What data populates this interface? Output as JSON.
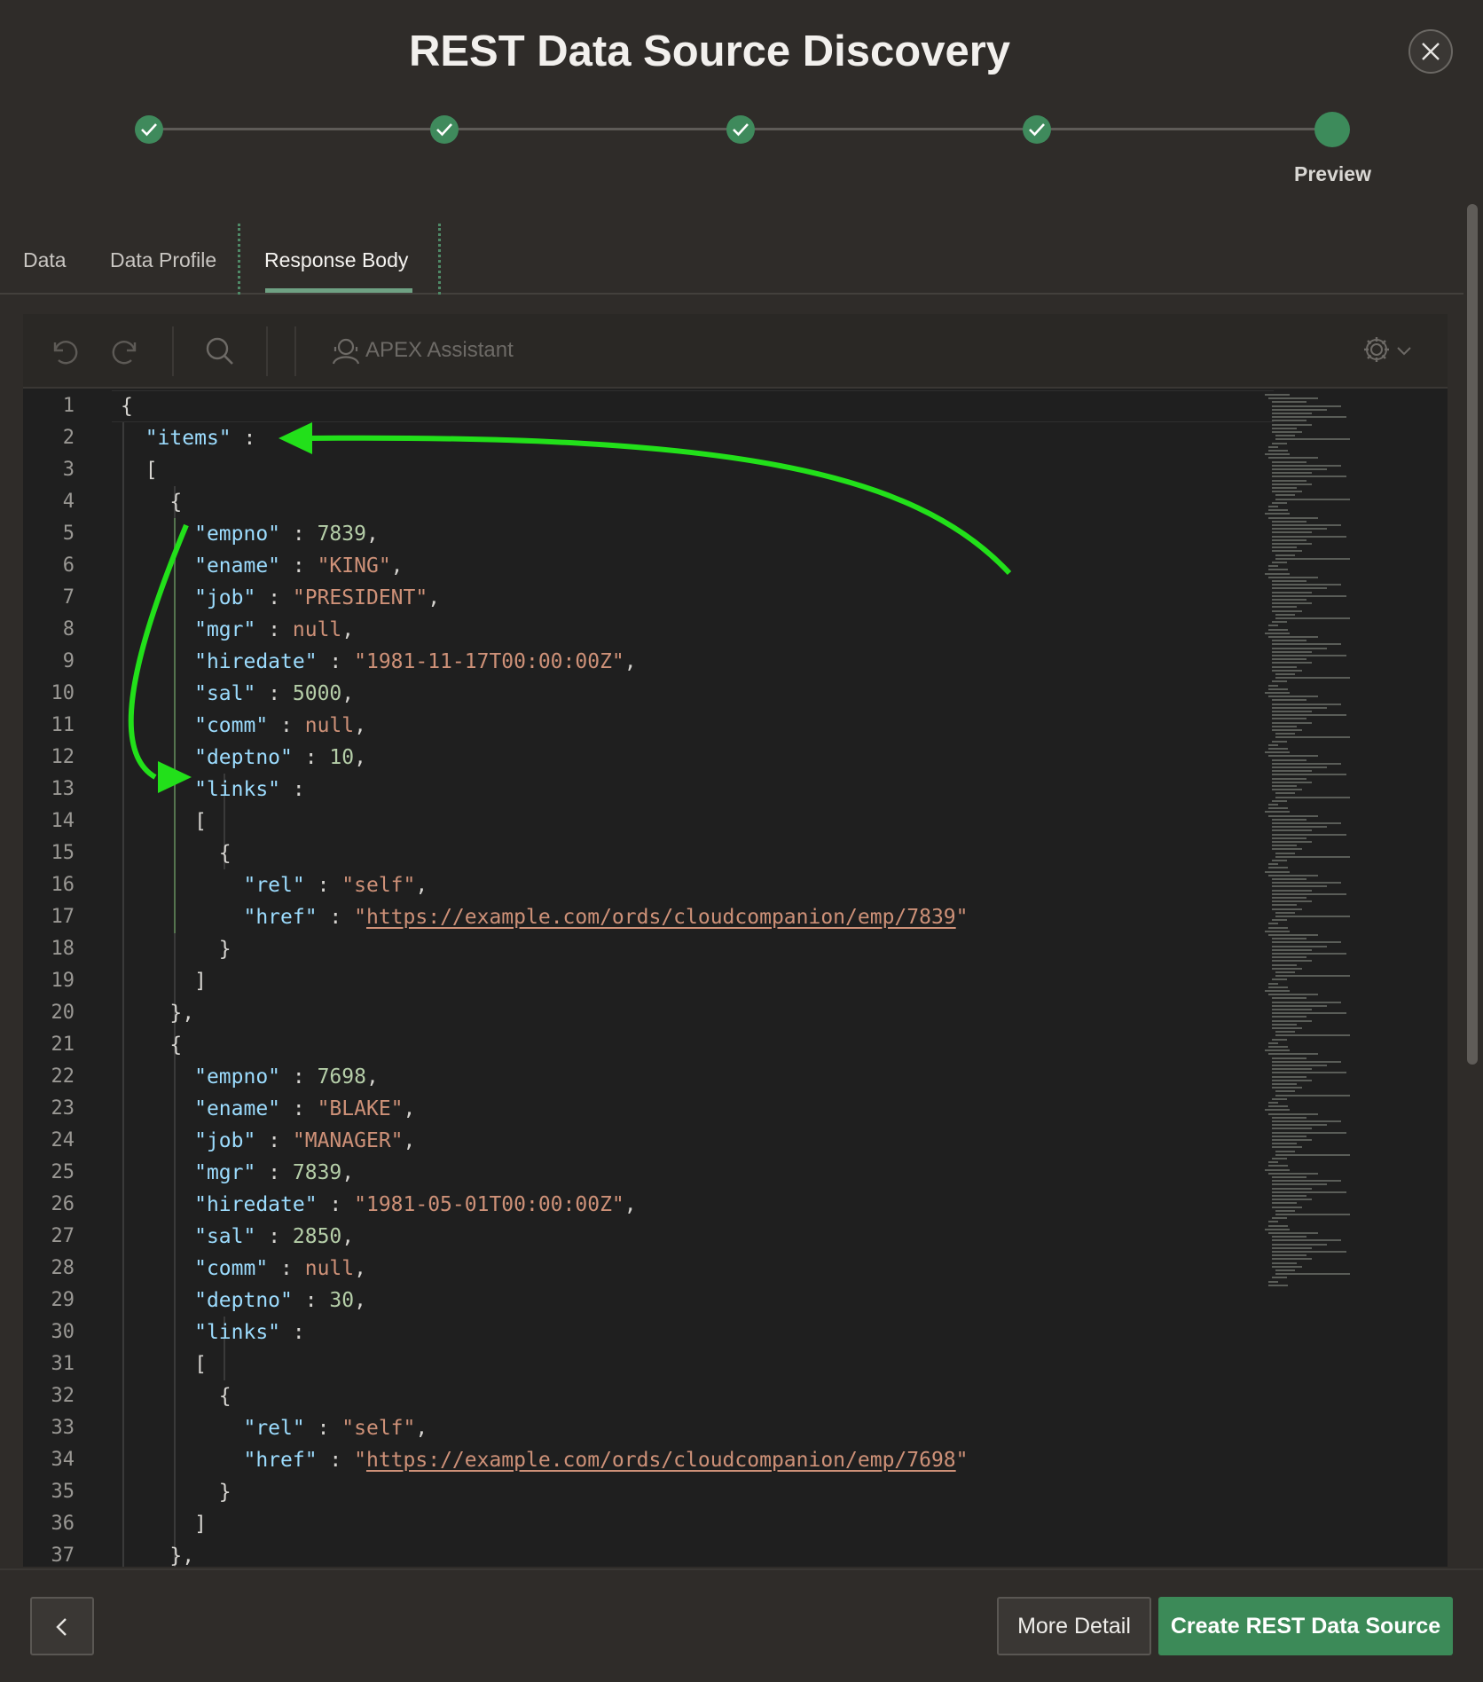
{
  "dialog": {
    "title": "REST Data Source Discovery",
    "close_icon": "close-icon"
  },
  "wizard": {
    "steps_completed": 4,
    "total_steps": 5,
    "current_label": "Preview"
  },
  "tabs": [
    {
      "label": "Data",
      "active": false
    },
    {
      "label": "Data Profile",
      "active": false
    },
    {
      "label": "Response Body",
      "active": true
    }
  ],
  "toolbar": {
    "undo_icon": "undo-icon",
    "redo_icon": "redo-icon",
    "search_icon": "search-icon",
    "assistant_label": "APEX Assistant",
    "settings_icon": "gear-icon"
  },
  "code": {
    "line_numbers": [
      "1",
      "2",
      "3",
      "4",
      "5",
      "6",
      "7",
      "8",
      "9",
      "10",
      "11",
      "12",
      "13",
      "14",
      "15",
      "16",
      "17",
      "18",
      "19",
      "20",
      "21",
      "22",
      "23",
      "24",
      "25",
      "26",
      "27",
      "28",
      "29",
      "30",
      "31",
      "32",
      "33",
      "34",
      "35",
      "36",
      "37"
    ],
    "records": [
      {
        "empno": "7839",
        "ename": "\"KING\"",
        "job": "\"PRESIDENT\"",
        "mgr": "null",
        "hiredate": "\"1981-11-17T00:00:00Z\"",
        "sal": "5000",
        "comm": "null",
        "deptno": "10",
        "rel": "\"self\"",
        "href": "https://example.com/ords/cloudcompanion/emp/7839"
      },
      {
        "empno": "7698",
        "ename": "\"BLAKE\"",
        "job": "\"MANAGER\"",
        "mgr": "7839",
        "hiredate": "\"1981-05-01T00:00:00Z\"",
        "sal": "2850",
        "comm": "null",
        "deptno": "30",
        "rel": "\"self\"",
        "href": "https://example.com/ords/cloudcompanion/emp/7698"
      }
    ],
    "keys": {
      "items": "\"items\"",
      "empno": "\"empno\"",
      "ename": "\"ename\"",
      "job": "\"job\"",
      "mgr": "\"mgr\"",
      "hiredate": "\"hiredate\"",
      "sal": "\"sal\"",
      "comm": "\"comm\"",
      "deptno": "\"deptno\"",
      "links": "\"links\"",
      "rel": "\"rel\"",
      "href": "\"href\""
    }
  },
  "footer": {
    "back_icon": "chevron-left-icon",
    "more_detail_label": "More Detail",
    "create_label": "Create REST Data Source"
  },
  "colors": {
    "accent_green": "#3c8a58",
    "annotation_arrow": "#22e01a",
    "json_key": "#9cdcfe",
    "json_string": "#ce9178",
    "json_number": "#b5cea8"
  }
}
